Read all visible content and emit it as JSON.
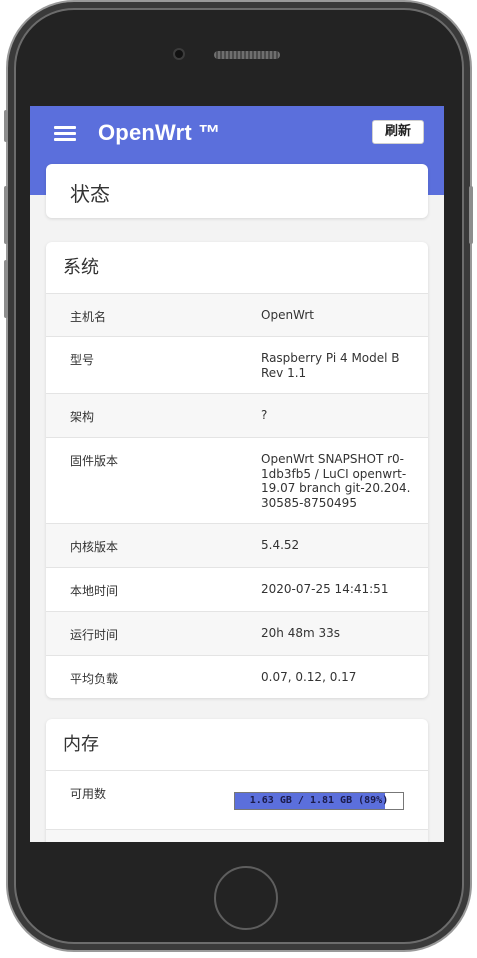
{
  "header": {
    "brand": "OpenWrt ™",
    "refresh_label": "刷新"
  },
  "page_title": "状态",
  "system": {
    "title": "系统",
    "rows": [
      {
        "label": "主机名",
        "value": "OpenWrt"
      },
      {
        "label": "型号",
        "value": "Raspberry Pi 4 Model B Rev 1.1"
      },
      {
        "label": "架构",
        "value": "?"
      },
      {
        "label": "固件版本",
        "value": "OpenWrt SNAPSHOT r0-1db3fb5 / LuCI openwrt-19.07 branch git-20.204.30585-8750495"
      },
      {
        "label": "内核版本",
        "value": "5.4.52"
      },
      {
        "label": "本地时间",
        "value": "2020-07-25 14:41:51"
      },
      {
        "label": "运行时间",
        "value": "20h 48m 33s"
      },
      {
        "label": "平均负载",
        "value": "0.07, 0.12, 0.17"
      }
    ]
  },
  "memory": {
    "title": "内存",
    "available_label": "可用数",
    "available_text": "1.63 GB / 1.81 GB (89%)",
    "available_fraction": 0.89
  },
  "colors": {
    "accent": "#5b6fdc",
    "phone_body": "#232323"
  },
  "icons": [
    "menu-icon"
  ]
}
